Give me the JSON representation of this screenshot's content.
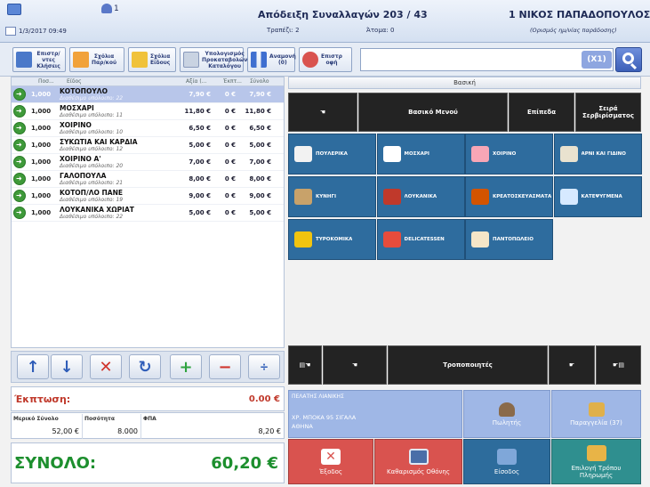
{
  "header": {
    "user_count": "1",
    "datetime": "1/3/2017 09:49",
    "receipt_title": "Απόδειξη Συναλλαγών 203 / 43",
    "table": "Τραπέζι: 2",
    "persons": "Άτομα: 0",
    "operator": "1 ΝΙΚΟΣ ΠΑΠΑΔΟΠΟΥΛΟΣ",
    "delivery_note": "(Ορισμός ημ/νίας παράδοσης)"
  },
  "toolbar": {
    "buttons": [
      "Επιστρ/ντες\nΚλήσεις",
      "Σχόλια\nΠαρ/κού",
      "Σχόλια\nΕίδους",
      "Υπολογισμός\nΠροκαταβολών\nΚαταλόγου",
      "Αναμονή\n(0)",
      "Επιστρ\nοφή"
    ],
    "quantity_badge": "(X1)"
  },
  "list": {
    "columns": [
      "Ποσ...",
      "Είδος",
      "Αξία (...",
      "Έκπτ...",
      "Σύνολο"
    ],
    "items": [
      {
        "qty": "1,000",
        "name": "ΚΟΤΟΠΟΥΛΟ",
        "sub": "Διαθέσιμο υπόλοιπο: 22",
        "price": "7,90 €",
        "disc": "0 €",
        "total": "7,90 €"
      },
      {
        "qty": "1,000",
        "name": "ΜΟΣΧΑΡΙ",
        "sub": "Διαθέσιμο υπόλοιπο: 11",
        "price": "11,80 €",
        "disc": "0 €",
        "total": "11,80 €"
      },
      {
        "qty": "1,000",
        "name": "ΧΟΙΡΙΝΟ",
        "sub": "Διαθέσιμο υπόλοιπο: 10",
        "price": "6,50 €",
        "disc": "0 €",
        "total": "6,50 €"
      },
      {
        "qty": "1,000",
        "name": "ΣΥΚΩΤΙΑ ΚΑΙ ΚΑΡΔΙΑ",
        "sub": "Διαθέσιμο υπόλοιπο: 12",
        "price": "5,00 €",
        "disc": "0 €",
        "total": "5,00 €"
      },
      {
        "qty": "1,000",
        "name": "ΧΟΙΡΙΝΟ Α'",
        "sub": "Διαθέσιμο υπόλοιπο: 20",
        "price": "7,00 €",
        "disc": "0 €",
        "total": "7,00 €"
      },
      {
        "qty": "1,000",
        "name": "ΓΑΛΟΠΟΥΛΑ",
        "sub": "Διαθέσιμο υπόλοιπο: 21",
        "price": "8,00 €",
        "disc": "0 €",
        "total": "8,00 €"
      },
      {
        "qty": "1,000",
        "name": "ΚΟΤΟΠ/ΛΟ ΠΑΝΕ",
        "sub": "Διαθέσιμο υπόλοιπο: 19",
        "price": "9,00 €",
        "disc": "0 €",
        "total": "9,00 €"
      },
      {
        "qty": "1,000",
        "name": "ΛΟΥΚΑΝΙΚΑ ΧΩΡΙΑΤ",
        "sub": "Διαθέσιμο υπόλοιπο: 22",
        "price": "5,00 €",
        "disc": "0 €",
        "total": "5,00 €"
      }
    ]
  },
  "totals": {
    "discount_label": "Έκπτωση:",
    "discount_value": "0.00 €",
    "subtotal_label": "Μερικό Σύνολο",
    "subtotal_value": "52,00 €",
    "quantity_label": "Ποσότητα",
    "quantity_value": "8.000",
    "vat_label": "ΦΠΑ",
    "vat_value": "8,20 €",
    "total_label": "ΣΥΝΟΛΟ:",
    "total_value": "60,20 €"
  },
  "categories": {
    "title": "Βασική",
    "menu": [
      "Βασικό Μενού",
      "Επίπεδα",
      "Σειρά\nΣερβιρίσματος"
    ],
    "items": [
      {
        "label": "ΠΟΥΛΕΡΙΚΑ",
        "icon": "chicken-icon",
        "color": "#f2f2f2"
      },
      {
        "label": "ΜΟΣΧΑΡΙ",
        "icon": "cow-icon",
        "color": "#ffffff"
      },
      {
        "label": "ΧΟΙΡΙΝΟ",
        "icon": "pig-icon",
        "color": "#f7a6b6"
      },
      {
        "label": "ΑΡΝΙ ΚΑΙ ΓΙΔΙΝΟ",
        "icon": "goat-icon",
        "color": "#e9e2cf"
      },
      {
        "label": "ΚΥΝΗΓΙ",
        "icon": "rabbit-icon",
        "color": "#c8a26a"
      },
      {
        "label": "ΛΟΥΚΑΝΙΚΑ",
        "icon": "sausage-icon",
        "color": "#c0392b"
      },
      {
        "label": "ΚΡΕΑΤΟΣΚΕΥΑΣΜΑΤΑ",
        "icon": "skewer-icon",
        "color": "#d35400"
      },
      {
        "label": "ΚΑΤΕΨΥΓΜΕΝΑ",
        "icon": "snowflake-icon",
        "color": "#d6e9ff"
      },
      {
        "label": "ΤΥΡΟΚΟΜΙΚΑ",
        "icon": "cheese-icon",
        "color": "#f1c40f"
      },
      {
        "label": "DELICATESSEN",
        "icon": "salami-icon",
        "color": "#e74c3c"
      },
      {
        "label": "ΠΑΝΤΟΠΩΛΕΙΟ",
        "icon": "bread-icon",
        "color": "#f5e6c8"
      }
    ],
    "modifiers_label": "Τροποποιητές"
  },
  "customer": {
    "header": "ΠΕΛΑΤΗΣ ΛΙΑΝΙΚΗΣ",
    "line1": "ΧΡ. ΜΠΟΚΑ 95 ΣΙΓΑΛΑ",
    "line2": "ΑΘΗΝΑ"
  },
  "actions": {
    "salesman": "Πωλητής",
    "orders": "Παραγγελία (37)",
    "exit": "Έξοδος",
    "clear": "Καθαρισμός Οθόνης",
    "login": "Είσοδος",
    "payment": "Επιλογή Τρόπου\nΠληρωμής"
  }
}
